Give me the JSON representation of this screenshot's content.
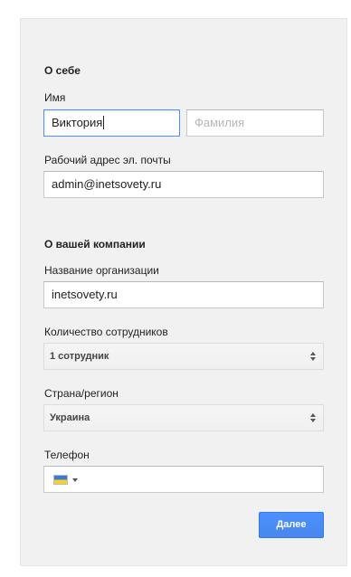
{
  "about": {
    "title": "О себе",
    "name_label": "Имя",
    "first_name_value": "Виктория",
    "last_name_placeholder": "Фамилия",
    "email_label": "Рабочий адрес эл. почты",
    "email_value": "admin@inetsovety.ru"
  },
  "company": {
    "title": "О вашей компании",
    "org_label": "Название организации",
    "org_value": "inetsovety.ru",
    "employees_label": "Количество сотрудников",
    "employees_selected": "1 сотрудник",
    "country_label": "Страна/регион",
    "country_selected": "Украина",
    "phone_label": "Телефон",
    "phone_value": "",
    "phone_country_flag": "ukraine-flag-icon"
  },
  "actions": {
    "next_label": "Далее"
  },
  "colors": {
    "accent": "#4d90fe",
    "panel_bg": "#f1f1f1"
  }
}
